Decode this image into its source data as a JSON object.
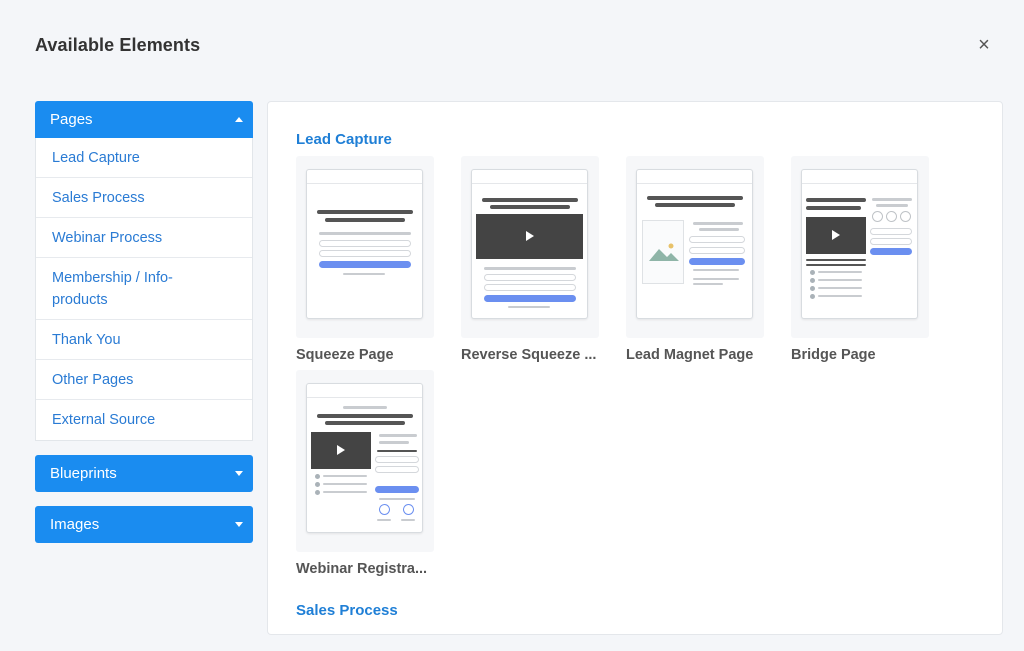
{
  "modal": {
    "title": "Available Elements",
    "close_symbol": "×"
  },
  "sidebar": {
    "pages": {
      "label": "Pages",
      "expanded": true,
      "items": [
        {
          "label": "Lead Capture"
        },
        {
          "label": "Sales Process"
        },
        {
          "label": "Webinar Process"
        },
        {
          "label": "Membership / Info-products"
        },
        {
          "label": "Thank You"
        },
        {
          "label": "Other Pages"
        },
        {
          "label": "External Source"
        }
      ]
    },
    "blueprints": {
      "label": "Blueprints",
      "expanded": false
    },
    "images": {
      "label": "Images",
      "expanded": false
    }
  },
  "main": {
    "section_title": "Lead Capture",
    "next_section_title": "Sales Process",
    "templates": [
      {
        "label": "Squeeze Page",
        "icon": "squeeze-page-thumbnail"
      },
      {
        "label": "Reverse Squeeze ...",
        "icon": "reverse-squeeze-thumbnail"
      },
      {
        "label": "Lead Magnet Page",
        "icon": "lead-magnet-thumbnail"
      },
      {
        "label": "Bridge Page",
        "icon": "bridge-page-thumbnail"
      },
      {
        "label": "Webinar Registra...",
        "icon": "webinar-registration-thumbnail"
      }
    ]
  },
  "colors": {
    "accent": "#1a8cf0",
    "link": "#2a7bd4",
    "cta": "#6b8ff0"
  }
}
